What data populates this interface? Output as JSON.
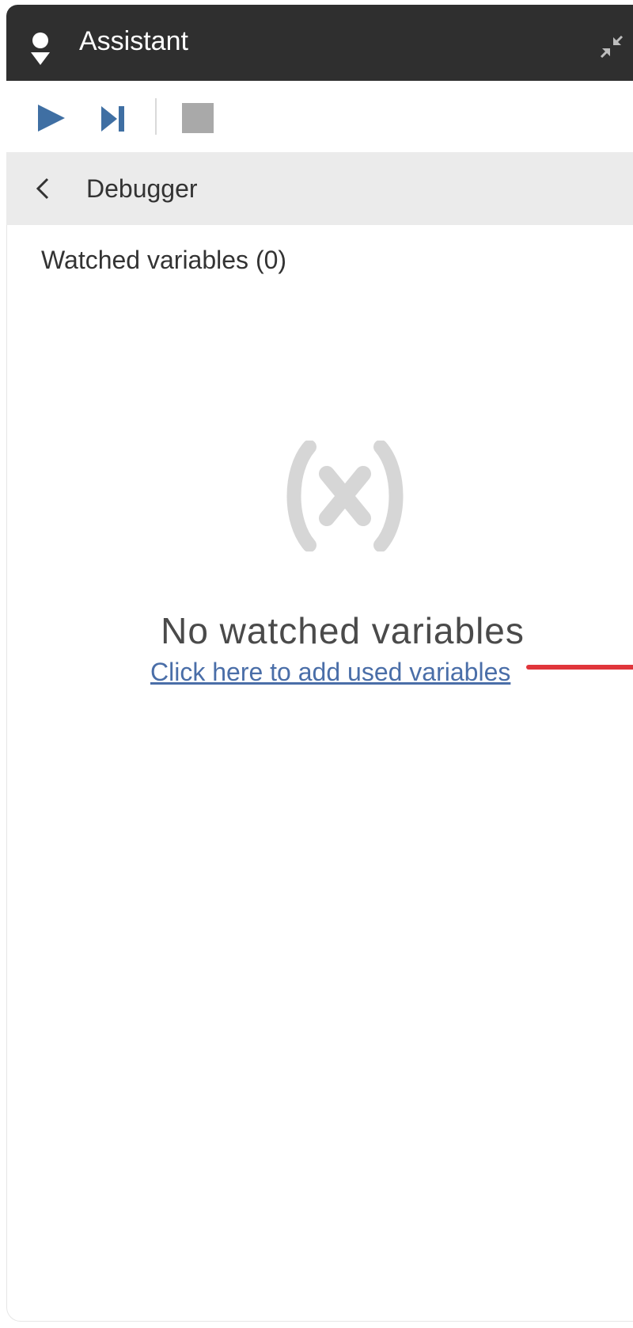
{
  "window": {
    "title": "Assistant",
    "icons": {
      "app": "assistant-person-icon",
      "collapse": "collapse-arrows-icon"
    }
  },
  "toolbar": {
    "buttons": [
      {
        "icon": "play-icon",
        "color": "#3f6fa3"
      },
      {
        "icon": "step-icon",
        "color": "#3f6fa3"
      },
      {
        "icon": "stop-icon",
        "color": "#a9a9a9"
      }
    ]
  },
  "nav": {
    "back_icon": "chevron-left-icon",
    "title": "Debugger"
  },
  "section": {
    "title": "Watched variables (0)"
  },
  "empty_state": {
    "icon_text": "(x)",
    "title": "No watched variables",
    "link": "Click here to add used variables"
  },
  "colors": {
    "titlebar_bg": "#2f2f2f",
    "nav_bg": "#ebebeb",
    "link": "#4a6ea8",
    "accent_pointer": "#e0353b"
  }
}
